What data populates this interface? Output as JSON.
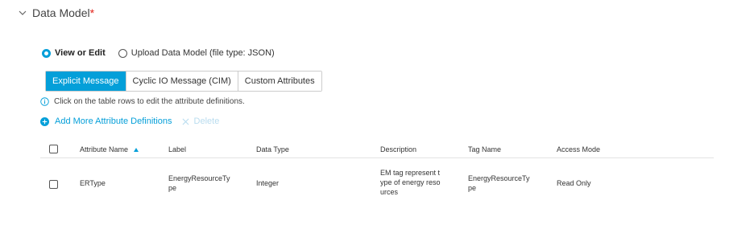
{
  "section": {
    "title": "Data Model",
    "required_mark": "*"
  },
  "radio": {
    "view_edit_label": "View or Edit",
    "upload_label": "Upload Data Model (file type: JSON)",
    "selected": "view_edit"
  },
  "tabs": [
    {
      "label": "Explicit Message",
      "active": true
    },
    {
      "label": "Cyclic IO Message (CIM)",
      "active": false
    },
    {
      "label": "Custom Attributes",
      "active": false
    }
  ],
  "info_text": "Click on the table rows to edit the attribute definitions.",
  "actions": {
    "add_label": "Add More Attribute Definitions",
    "delete_label": "Delete"
  },
  "table": {
    "headers": {
      "name": "Attribute Name",
      "label": "Label",
      "data_type": "Data Type",
      "description": "Description",
      "tag_name": "Tag Name",
      "access_mode": "Access Mode"
    },
    "rows": [
      {
        "name": "ERType",
        "label_lines": [
          "EnergyResourceTy",
          "pe"
        ],
        "data_type": "Integer",
        "description_lines": [
          "EM tag represent t",
          "ype of energy reso",
          "urces"
        ],
        "tag_lines": [
          "EnergyResourceTy",
          "pe"
        ],
        "access_mode": "Read Only"
      }
    ]
  },
  "colors": {
    "accent": "#049fd9",
    "required": "#e2231a",
    "disabled": "#b9dcef"
  },
  "icons": {
    "section_toggle": "chevron-down-icon",
    "info": "info-icon",
    "add": "plus-circle-icon",
    "delete": "close-icon",
    "sort": "sort-ascending-icon"
  }
}
